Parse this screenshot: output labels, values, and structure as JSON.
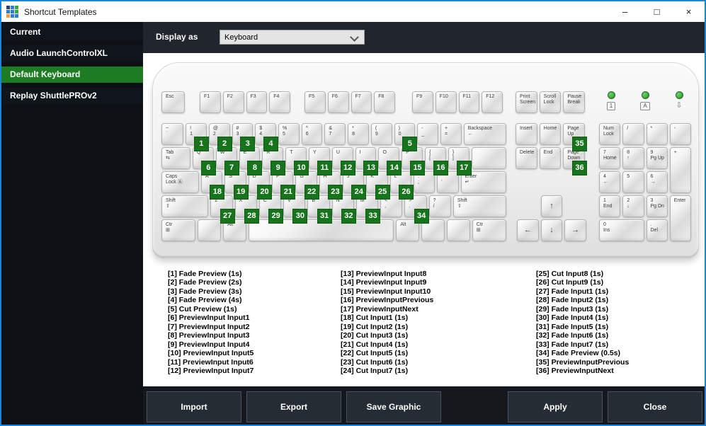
{
  "window": {
    "title": "Shortcut Templates",
    "controls": {
      "minimize": "–",
      "maximize": "□",
      "close": "×"
    },
    "icon_colors": [
      "#24407c",
      "#2d7dd2",
      "#37a93c",
      "#2d7dd2",
      "#2d7dd2",
      "#37a93c",
      "#f0a030",
      "#2d7dd2",
      "#2d7dd2"
    ]
  },
  "colors": {
    "accent_blue": "#1a85da",
    "selected_green": "#1e7d22",
    "badge_green": "#17731c"
  },
  "sidebar": {
    "items": [
      {
        "id": "current",
        "label": "Current",
        "selected": false
      },
      {
        "id": "audio-launchcontrolxl",
        "label": "Audio LaunchControlXL",
        "selected": false
      },
      {
        "id": "default-keyboard",
        "label": "Default Keyboard",
        "selected": true
      },
      {
        "id": "replay-shuttleprov2",
        "label": "Replay ShuttlePROv2",
        "selected": false
      }
    ]
  },
  "toolbar": {
    "display_as_label": "Display as",
    "display_mode": "Keyboard"
  },
  "keyboard": {
    "function_groups": [
      [
        "Esc"
      ],
      [
        "F1",
        "F2",
        "F3",
        "F4"
      ],
      [
        "F5",
        "F6",
        "F7",
        "F8"
      ],
      [
        "F9",
        "F10",
        "F11",
        "F12"
      ],
      [
        "Print\nScreen",
        "Scroll\nLock",
        "Pause\nBreak"
      ]
    ],
    "leds": [
      {
        "glyph": "1",
        "boxed": true
      },
      {
        "glyph": "A",
        "boxed": true
      },
      {
        "glyph": "⇩",
        "boxed": false
      }
    ],
    "main_rows": [
      [
        {
          "l": "~\n`",
          "w": 1.05
        },
        {
          "l": "!\n1",
          "w": 1,
          "b": 1
        },
        {
          "l": "@\n2",
          "w": 1,
          "b": 2
        },
        {
          "l": "#\n3",
          "w": 1,
          "b": 3
        },
        {
          "l": "$\n4",
          "w": 1,
          "b": 4
        },
        {
          "l": "%\n5",
          "w": 1
        },
        {
          "l": "^\n6",
          "w": 1
        },
        {
          "l": "&\n7",
          "w": 1
        },
        {
          "l": "*\n8",
          "w": 1
        },
        {
          "l": "(\n9",
          "w": 1
        },
        {
          "l": ")\n0",
          "w": 1,
          "b": 5
        },
        {
          "l": "-\n_",
          "w": 1
        },
        {
          "l": "+\n=",
          "w": 1
        },
        {
          "l": "Backspace\n←",
          "w": 2.1
        }
      ],
      [
        {
          "l": "Tab\n⇆",
          "w": 1.4
        },
        {
          "l": "Q",
          "w": 1,
          "b": 6
        },
        {
          "l": "W",
          "w": 1,
          "b": 7
        },
        {
          "l": "E",
          "w": 1,
          "b": 8
        },
        {
          "l": "R",
          "w": 1,
          "b": 9
        },
        {
          "l": "T",
          "w": 1,
          "b": 10
        },
        {
          "l": "Y",
          "w": 1,
          "b": 11
        },
        {
          "l": "U",
          "w": 1,
          "b": 12
        },
        {
          "l": "I",
          "w": 1,
          "b": 13
        },
        {
          "l": "O",
          "w": 1,
          "b": 14
        },
        {
          "l": "P",
          "w": 1,
          "b": 15
        },
        {
          "l": "{\n[",
          "w": 1,
          "b": 16
        },
        {
          "l": "}\n]",
          "w": 1,
          "b": 17
        },
        {
          "l": "",
          "w": 1.7
        }
      ],
      [
        {
          "l": "Caps\nLock Ⓐ",
          "w": 1.8
        },
        {
          "l": "A",
          "w": 1,
          "b": 18
        },
        {
          "l": "S",
          "w": 1,
          "b": 19
        },
        {
          "l": "D",
          "w": 1,
          "b": 20
        },
        {
          "l": "F",
          "w": 1,
          "b": 21
        },
        {
          "l": "G",
          "w": 1,
          "b": 22
        },
        {
          "l": "H",
          "w": 1,
          "b": 23
        },
        {
          "l": "J",
          "w": 1,
          "b": 24
        },
        {
          "l": "K",
          "w": 1,
          "b": 25
        },
        {
          "l": "L",
          "w": 1,
          "b": 26
        },
        {
          "l": ":\n;",
          "w": 1
        },
        {
          "l": "\"\n'",
          "w": 1
        },
        {
          "l": "Enter\n↵",
          "w": 2.2
        }
      ],
      [
        {
          "l": "Shift\n⇧",
          "w": 2.2
        },
        {
          "l": "Z",
          "w": 1,
          "b": 27
        },
        {
          "l": "X",
          "w": 1,
          "b": 28
        },
        {
          "l": "C",
          "w": 1,
          "b": 29
        },
        {
          "l": "V",
          "w": 1,
          "b": 30
        },
        {
          "l": "B",
          "w": 1,
          "b": 31
        },
        {
          "l": "N",
          "w": 1,
          "b": 32
        },
        {
          "l": "M",
          "w": 1,
          "b": 33
        },
        {
          "l": "<\n,",
          "w": 1
        },
        {
          "l": ">\n.",
          "w": 1,
          "b": 34
        },
        {
          "l": "?\n/",
          "w": 1
        },
        {
          "l": "Shift\n⇧",
          "w": 2.5
        }
      ],
      [
        {
          "l": "Ctr\n⊞",
          "w": 1.5
        },
        {
          "l": "",
          "w": 1
        },
        {
          "l": "Alt",
          "w": 1
        },
        {
          "l": "",
          "w": 6.6
        },
        {
          "l": "Alt",
          "w": 1
        },
        {
          "l": "",
          "w": 1
        },
        {
          "l": "",
          "w": 1
        },
        {
          "l": "Ctr\n⊞",
          "w": 1.5
        }
      ]
    ],
    "nav_keys": [
      {
        "l": "Insert"
      },
      {
        "l": "Home"
      },
      {
        "l": "Page\nUp",
        "b": 35
      },
      {
        "l": "Delete"
      },
      {
        "l": "End"
      },
      {
        "l": "Page\nDown",
        "b": 36
      }
    ],
    "arrow_keys": [
      {
        "l": "↑"
      },
      {
        "l": "←"
      },
      {
        "l": "↓"
      },
      {
        "l": "→"
      }
    ],
    "numpad_keys": [
      {
        "l": "Num\nLock"
      },
      {
        "l": "/"
      },
      {
        "l": "*"
      },
      {
        "l": "-"
      },
      {
        "l": "7\nHome"
      },
      {
        "l": "8\n↑"
      },
      {
        "l": "9\nPg Up"
      },
      {
        "l": "+",
        "cls": "tall"
      },
      {
        "l": "4\n←"
      },
      {
        "l": "5"
      },
      {
        "l": "6\n→"
      },
      {
        "l": "1\nEnd"
      },
      {
        "l": "2\n↓"
      },
      {
        "l": "3\nPg Dn"
      },
      {
        "l": "Enter",
        "cls": "tall"
      },
      {
        "l": "0\nIns",
        "cls": "wide"
      },
      {
        "l": ".\nDel"
      }
    ]
  },
  "legend": {
    "columns": [
      [
        "[1] Fade Preview (1s)",
        "[2] Fade Preview (2s)",
        "[3] Fade Preview (3s)",
        "[4] Fade Preview (4s)",
        "[5] Cut Preview (1s)",
        "[6] PreviewInput Input1",
        "[7] PreviewInput Input2",
        "[8] PreviewInput Input3",
        "[9] PreviewInput Input4",
        "[10] PreviewInput Input5",
        "[11] PreviewInput Input6",
        "[12] PreviewInput Input7"
      ],
      [
        "[13] PreviewInput Input8",
        "[14] PreviewInput Input9",
        "[15] PreviewInput Input10",
        "[16] PreviewInputPrevious",
        "[17] PreviewInputNext",
        "[18] Cut Input1 (1s)",
        "[19] Cut Input2 (1s)",
        "[20] Cut Input3 (1s)",
        "[21] Cut Input4 (1s)",
        "[22] Cut Input5 (1s)",
        "[23] Cut Input6 (1s)",
        "[24] Cut Input7 (1s)"
      ],
      [
        "[25] Cut Input8 (1s)",
        "[26] Cut Input9 (1s)",
        "[27] Fade Input1 (1s)",
        "[28] Fade Input2 (1s)",
        "[29] Fade Input3 (1s)",
        "[30] Fade Input4 (1s)",
        "[31] Fade Input5 (1s)",
        "[32] Fade Input6 (1s)",
        "[33] Fade Input7 (1s)",
        "[34] Fade Preview (0.5s)",
        "[35] PreviewInputPrevious",
        "[36] PreviewInputNext"
      ]
    ]
  },
  "footer": {
    "buttons": [
      {
        "id": "import",
        "label": "Import"
      },
      {
        "id": "export",
        "label": "Export"
      },
      {
        "id": "save-graphic",
        "label": "Save Graphic"
      },
      {
        "id": "apply",
        "label": "Apply"
      },
      {
        "id": "close",
        "label": "Close"
      }
    ]
  }
}
